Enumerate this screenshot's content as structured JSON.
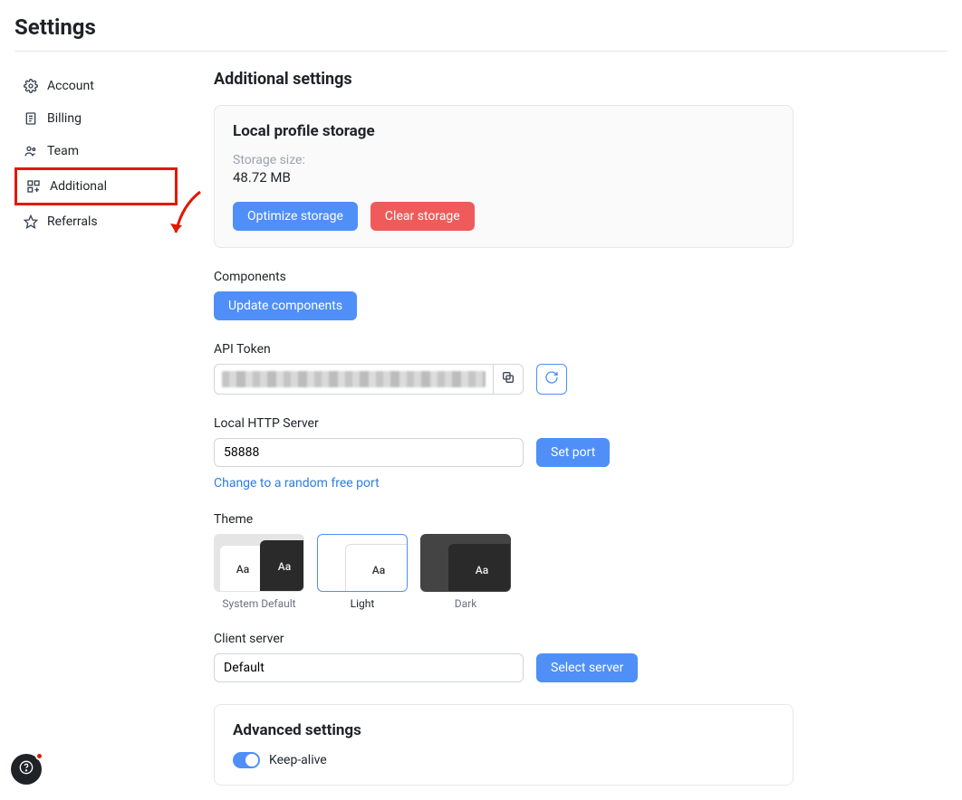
{
  "page": {
    "title": "Settings"
  },
  "sidebar": {
    "items": [
      {
        "label": "Account"
      },
      {
        "label": "Billing"
      },
      {
        "label": "Team"
      },
      {
        "label": "Additional"
      },
      {
        "label": "Referrals"
      }
    ],
    "active_index": 3
  },
  "main": {
    "heading": "Additional settings",
    "storage": {
      "title": "Local profile storage",
      "size_label": "Storage size:",
      "size_value": "48.72 MB",
      "optimize_btn": "Optimize storage",
      "clear_btn": "Clear storage"
    },
    "components": {
      "label": "Components",
      "update_btn": "Update components"
    },
    "api_token": {
      "label": "API Token"
    },
    "http_server": {
      "label": "Local HTTP Server",
      "value": "58888",
      "set_port_btn": "Set port",
      "random_link": "Change to a random free port"
    },
    "theme": {
      "label": "Theme",
      "options": [
        {
          "name": "System Default"
        },
        {
          "name": "Light"
        },
        {
          "name": "Dark"
        }
      ],
      "selected_index": 1,
      "preview_text": "Aa"
    },
    "client_server": {
      "label": "Client server",
      "value": "Default",
      "select_btn": "Select server"
    },
    "advanced": {
      "title": "Advanced settings",
      "keep_alive_label": "Keep-alive",
      "keep_alive_on": true
    }
  }
}
